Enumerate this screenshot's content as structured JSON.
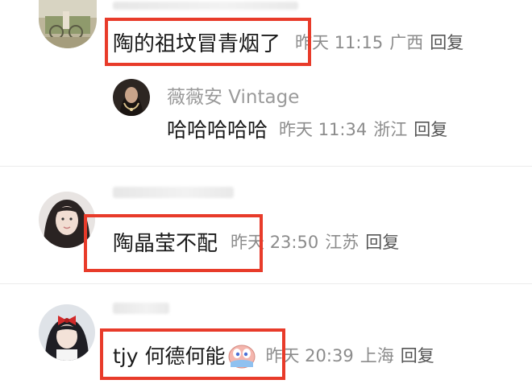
{
  "top_name_blurred": "",
  "comments": [
    {
      "text": "陶的祖坟冒青烟了",
      "time": "昨天 11:15",
      "location": "广西",
      "reply_label": "回复",
      "reply": {
        "name": "薇薇安 Vintage",
        "text": "哈哈哈哈哈",
        "time": "昨天 11:34",
        "location": "浙江",
        "reply_label": "回复"
      }
    },
    {
      "text": "陶晶莹不配",
      "time": "昨天 23:50",
      "location": "江苏",
      "reply_label": "回复"
    },
    {
      "text": "tjy 何德何能",
      "time": "昨天 20:39",
      "location": "上海",
      "reply_label": "回复"
    }
  ],
  "colors": {
    "highlight": "#e83b2a",
    "meta": "#8c8c8c",
    "text": "#1a1a1a"
  },
  "icons": {
    "reply_emoji": "peeking-face-icon"
  }
}
